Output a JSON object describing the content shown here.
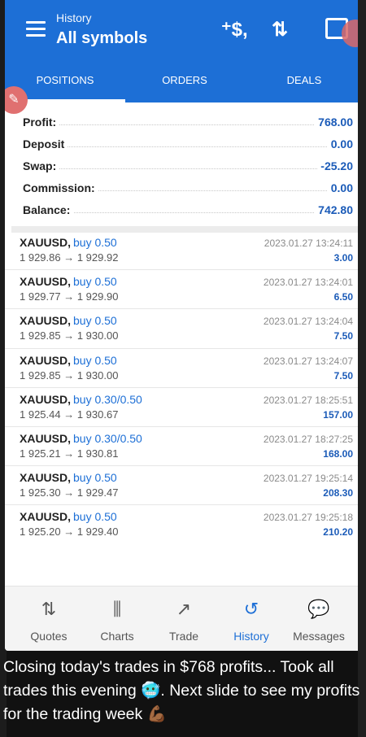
{
  "header": {
    "subtitle": "History",
    "title": "All symbols"
  },
  "tabs": [
    {
      "label": "POSITIONS",
      "active": true
    },
    {
      "label": "ORDERS",
      "active": false
    },
    {
      "label": "DEALS",
      "active": false
    }
  ],
  "summary": {
    "profit_label": "Profit:",
    "profit": "768.00",
    "deposit_label": "Deposit",
    "deposit": "0.00",
    "swap_label": "Swap:",
    "swap": "-25.20",
    "commission_label": "Commission:",
    "commission": "0.00",
    "balance_label": "Balance:",
    "balance": "742.80"
  },
  "trades": [
    {
      "symbol": "XAUUSD,",
      "side": "buy 0.50",
      "prices": "1 929.86 → 1 929.92",
      "time": "2023.01.27 13:24:11",
      "profit": "3.00"
    },
    {
      "symbol": "XAUUSD,",
      "side": "buy 0.50",
      "prices": "1 929.77 → 1 929.90",
      "time": "2023.01.27 13:24:01",
      "profit": "6.50"
    },
    {
      "symbol": "XAUUSD,",
      "side": "buy 0.50",
      "prices": "1 929.85 → 1 930.00",
      "time": "2023.01.27 13:24:04",
      "profit": "7.50"
    },
    {
      "symbol": "XAUUSD,",
      "side": "buy 0.50",
      "prices": "1 929.85 → 1 930.00",
      "time": "2023.01.27 13:24:07",
      "profit": "7.50"
    },
    {
      "symbol": "XAUUSD,",
      "side": "buy 0.30/0.50",
      "prices": "1 925.44 → 1 930.67",
      "time": "2023.01.27 18:25:51",
      "profit": "157.00"
    },
    {
      "symbol": "XAUUSD,",
      "side": "buy 0.30/0.50",
      "prices": "1 925.21 → 1 930.81",
      "time": "2023.01.27 18:27:25",
      "profit": "168.00"
    },
    {
      "symbol": "XAUUSD,",
      "side": "buy 0.50",
      "prices": "1 925.30 → 1 929.47",
      "time": "2023.01.27 19:25:14",
      "profit": "208.30"
    },
    {
      "symbol": "XAUUSD,",
      "side": "buy 0.50",
      "prices": "1 925.20 → 1 929.40",
      "time": "2023.01.27 19:25:18",
      "profit": "210.20"
    }
  ],
  "bottom_nav": [
    {
      "label": "Quotes",
      "icon": "quotes-icon",
      "glyph": "⇅",
      "active": false
    },
    {
      "label": "Charts",
      "icon": "charts-icon",
      "glyph": "⫼",
      "active": false
    },
    {
      "label": "Trade",
      "icon": "trade-icon",
      "glyph": "↗",
      "active": false
    },
    {
      "label": "History",
      "icon": "history-icon",
      "glyph": "↺",
      "active": true
    },
    {
      "label": "Messages",
      "icon": "messages-icon",
      "glyph": "💬",
      "active": false
    }
  ],
  "caption": "Closing today's trades in $768 profits... Took all trades this evening 🥶. Next slide to see my profits for the trading week 💪🏾",
  "colors": {
    "brand": "#1d6fd6",
    "value": "#1b5bb8"
  }
}
